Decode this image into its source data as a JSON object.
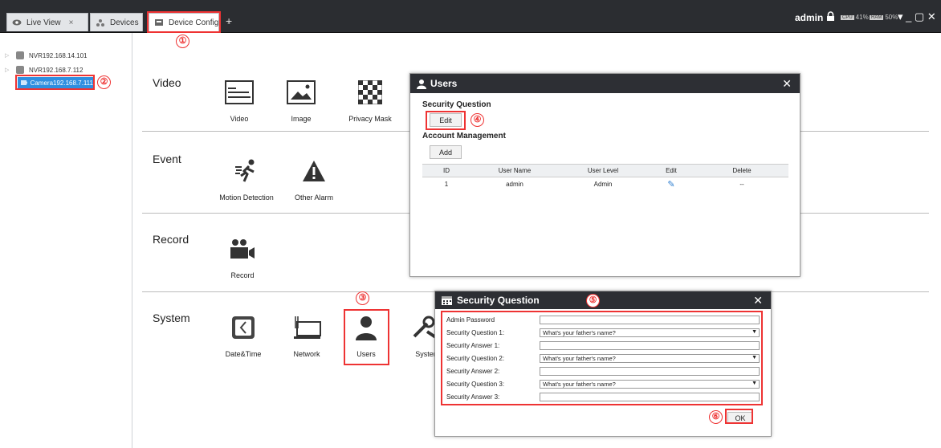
{
  "tabs": [
    {
      "label": "Live View",
      "close": "×"
    },
    {
      "label": "Devices",
      "close": "×"
    },
    {
      "label": "Device Config",
      "close": "×"
    }
  ],
  "new_tab": "+",
  "topbar_right": {
    "user": "admin",
    "cpu_label": "CPU",
    "cpu": "41%",
    "ram_label": "RAM",
    "ram": "50%",
    "controls": "▾ _ ▢ ✕"
  },
  "tree": [
    {
      "label": "NVR192.168.14.101"
    },
    {
      "label": "NVR192.168.7.112"
    },
    {
      "label": "Camera192.168.7.111"
    }
  ],
  "sections": {
    "video": {
      "title": "Video",
      "items": [
        "Video",
        "Image",
        "Privacy Mask"
      ]
    },
    "event": {
      "title": "Event",
      "items": [
        "Motion Detection",
        "Other Alarm"
      ]
    },
    "record": {
      "title": "Record",
      "items": [
        "Record"
      ]
    },
    "system": {
      "title": "System",
      "items": [
        "Date&Time",
        "Network",
        "Users",
        "Syster"
      ]
    }
  },
  "users_dialog": {
    "title": "Users",
    "close": "✕",
    "security_question_label": "Security Question",
    "edit_button": "Edit",
    "account_management_label": "Account Management",
    "add_button": "Add",
    "columns": [
      "ID",
      "User Name",
      "User Level",
      "Edit",
      "Delete"
    ],
    "rows": [
      {
        "id": "1",
        "name": "admin",
        "level": "Admin",
        "edit": "✎",
        "delete": "--"
      }
    ]
  },
  "sq_dialog": {
    "title": "Security Question",
    "close": "✕",
    "fields": [
      {
        "label": "Admin Password",
        "value": ""
      },
      {
        "label": "Security Question 1:",
        "value": "What's your father's name?",
        "dropdown": true
      },
      {
        "label": "Security Answer 1:",
        "value": ""
      },
      {
        "label": "Security Question 2:",
        "value": "What's your father's name?",
        "dropdown": true
      },
      {
        "label": "Security Answer 2:",
        "value": ""
      },
      {
        "label": "Security Question 3:",
        "value": "What's your father's name?",
        "dropdown": true
      },
      {
        "label": "Security Answer 3:",
        "value": ""
      }
    ],
    "ok_button": "OK"
  },
  "callouts": [
    "①",
    "②",
    "③",
    "④",
    "⑤",
    "⑥"
  ],
  "colors": {
    "accent_red": "#e33333",
    "selected_blue": "#2f8fe0",
    "titlebar": "#2d2f34"
  }
}
